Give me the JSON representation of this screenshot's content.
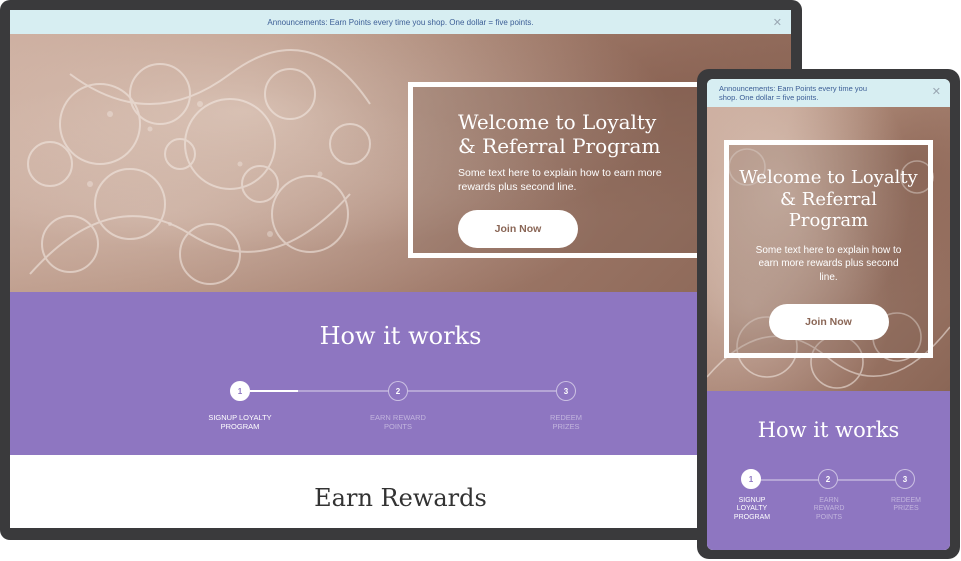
{
  "announcement": {
    "text": "Announcements: Earn Points every time you shop. One dollar = five points.",
    "close_icon": "close-icon"
  },
  "hero": {
    "title": "Welcome to Loyalty & Referral Program",
    "text": "Some text here to explain how to earn more rewards plus second line.",
    "button_label": "Join Now"
  },
  "how_it_works": {
    "title": "How it works",
    "progress": 0.33,
    "steps": [
      {
        "number": "1",
        "label": "SIGNUP LOYALTY PROGRAM",
        "active": true
      },
      {
        "number": "2",
        "label": "EARN REWARD POINTS",
        "active": false
      },
      {
        "number": "3",
        "label": "REDEEM PRIZES",
        "active": false
      }
    ]
  },
  "earn_rewards": {
    "title": "Earn Rewards"
  },
  "colors": {
    "announcement_bg": "#d7eef2",
    "announcement_text": "#3c5e96",
    "purple": "#8e76c1",
    "device_frame": "#3a3a3c"
  }
}
